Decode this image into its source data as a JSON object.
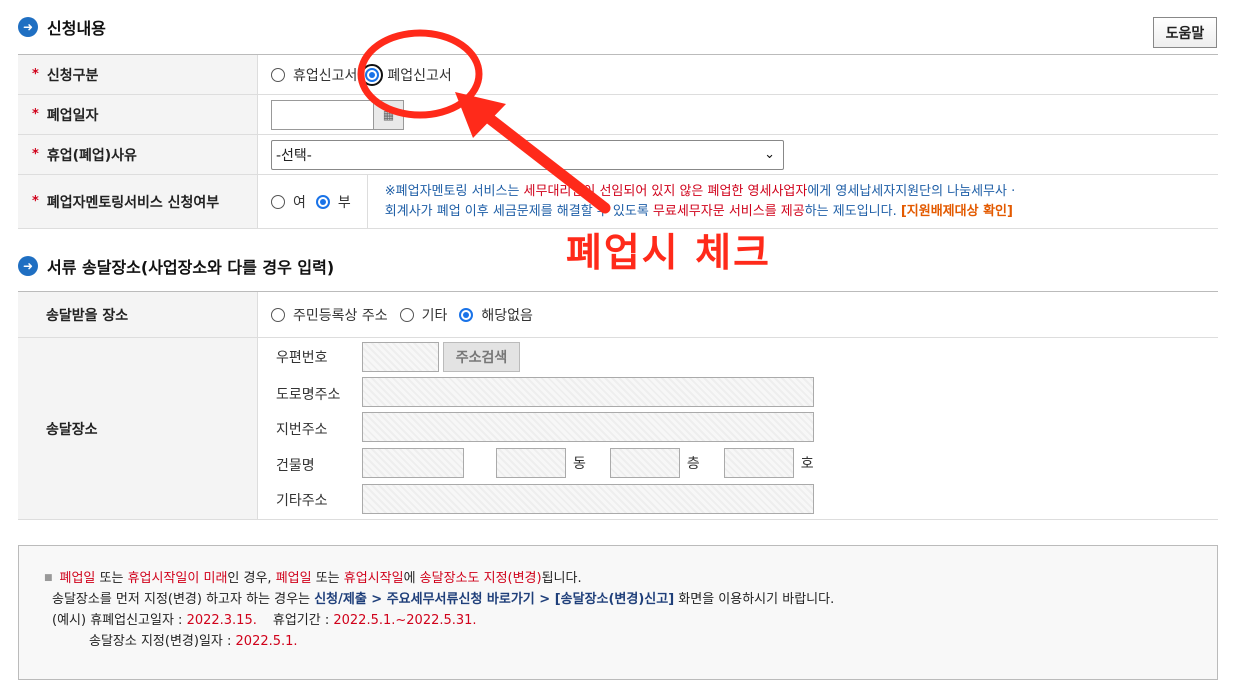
{
  "section1": {
    "title": "신청내용",
    "help_label": "도움말"
  },
  "rows": {
    "type": {
      "label": "신청구분",
      "opt1": "휴업신고서",
      "opt2": "폐업신고서",
      "selected": "폐업신고서"
    },
    "date": {
      "label": "폐업일자",
      "value": ""
    },
    "reason": {
      "label": "휴업(폐업)사유",
      "value": "-선택-"
    },
    "mentoring": {
      "label": "폐업자멘토링서비스 신청여부",
      "opt_yes": "여",
      "opt_no": "부",
      "selected": "부",
      "n1": "※폐업자멘토링 서비스는 ",
      "n2": "세무대리인이 선임되어 있지 않은 폐업한 영세사업자",
      "n3": "에게 영세납세자지원단의 나눔세무사 · ",
      "n4": "회계사가 폐업 이후 세금문제를 해결할 수 있도록 ",
      "n5": "무료세무자문 서비스를 제공",
      "n6": "하는 제도입니다. ",
      "n7": "[지원배제대상 확인]"
    }
  },
  "section2": {
    "title": "서류 송달장소(사업장소와 다를 경우 입력)"
  },
  "delivery": {
    "place_label": "송달받을 장소",
    "opt1": "주민등록상 주소",
    "opt2": "기타",
    "opt3": "해당없음",
    "selected": "해당없음",
    "addr_label": "송달장소",
    "zip_label": "우편번호",
    "zip_btn": "주소검색",
    "road_label": "도로명주소",
    "lot_label": "지번주소",
    "bldg_label": "건물명",
    "dong": "동",
    "floor": "층",
    "ho": "호",
    "etc_label": "기타주소"
  },
  "info": {
    "l1a": "폐업일",
    "l1b": " 또는 ",
    "l1c": "휴업시작일이 미래",
    "l1d": "인 경우, ",
    "l1e": "폐업일",
    "l1f": " 또는 ",
    "l1g": "휴업시작일",
    "l1h": "에 ",
    "l1i": "송달장소도 지정(변경)",
    "l1j": "됩니다.",
    "l2a": "송달장소를 먼저 지정(변경) 하고자 하는 경우는 ",
    "l2b": "신청/제출 > 주요세무서류신청 바로가기 > [송달장소(변경)신고]",
    "l2c": " 화면을 이용하시기 바랍니다.",
    "l3a": "(예시) 휴폐업신고일자 : ",
    "l3b": "2022.3.15.",
    "l3c": "휴업기간 : ",
    "l3d": "2022.5.1.~2022.5.31.",
    "l4a": "송달장소 지정(변경)일자 : ",
    "l4b": "2022.5.1."
  },
  "annotation": {
    "text": "폐업시 체크",
    "color": "#ff2a1a"
  },
  "colors": {
    "accent": "#1f6fc2",
    "required": "#d0021b",
    "radio": "#1a73e8"
  }
}
